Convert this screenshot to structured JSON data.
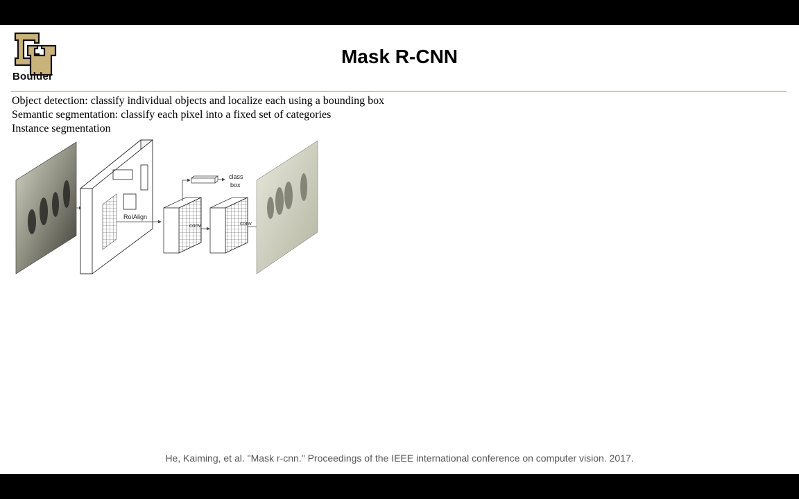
{
  "slide": {
    "logo_text": "Boulder",
    "title": "Mask R-CNN",
    "bullets": [
      "Object detection: classify individual objects and localize each using a bounding box",
      "Semantic segmentation: classify each pixel into a fixed set of categories",
      "Instance segmentation"
    ],
    "diagram": {
      "roialign_label": "RoIAlign",
      "conv_label_1": "conv",
      "conv_label_2": "conv",
      "class_label": "class",
      "box_label": "box"
    },
    "citation": "He, Kaiming, et al. \"Mask r-cnn.\" Proceedings of the IEEE international conference on computer vision. 2017."
  }
}
